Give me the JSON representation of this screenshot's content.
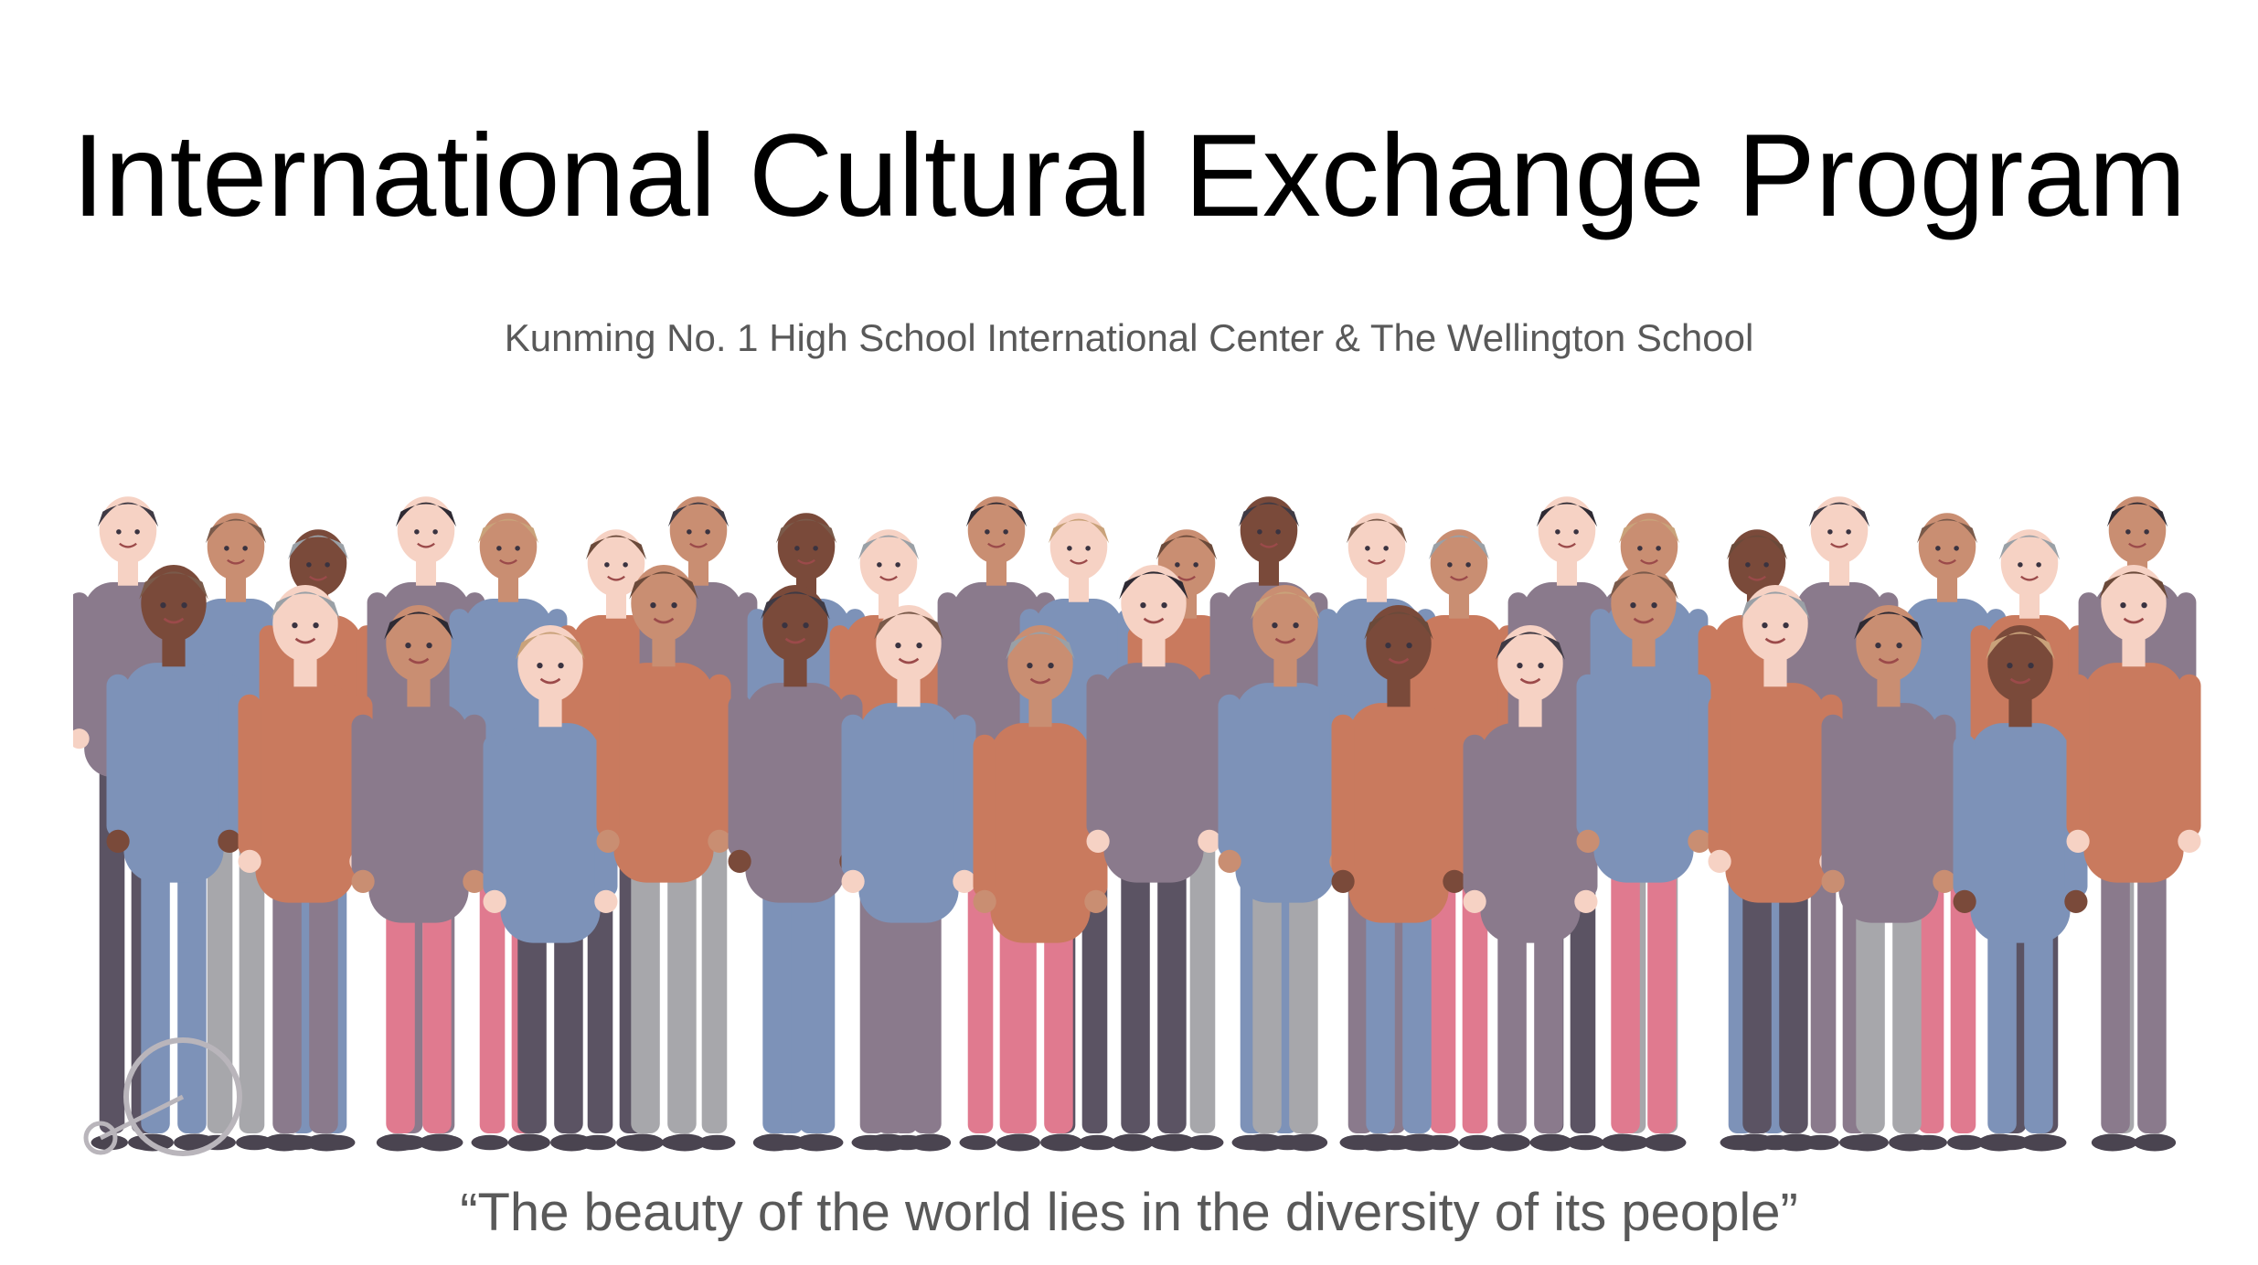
{
  "slide": {
    "title": "International Cultural Exchange Program",
    "subtitle": "Kunming No. 1 High School International Center & The Wellington School",
    "quote": "“The beauty of the world lies in the diversity of its people”"
  },
  "illustration": {
    "icon": "diverse-crowd-illustration",
    "colors": {
      "skin_light": "#f6d2c4",
      "skin_mid": "#c98e72",
      "skin_dark": "#7a4a3a",
      "mauve": "#8a7a8c",
      "pink": "#e07a8f",
      "mustard": "#e8b84e",
      "denim": "#7d92b8",
      "teal": "#5e9aa0",
      "grey": "#a7a7ab",
      "rust": "#c97a5e",
      "cream": "#f3ede6",
      "dark": "#5b5363"
    }
  }
}
